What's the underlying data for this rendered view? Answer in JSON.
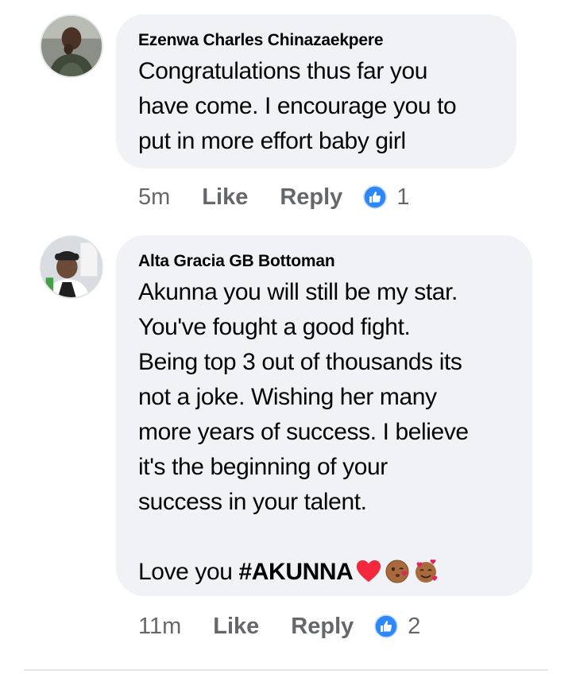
{
  "comments": [
    {
      "author": "Ezenwa Charles Chinazaekpere",
      "lines": [
        "Congratulations thus far you",
        "have come. I encourage you to",
        "put in more effort baby girl"
      ],
      "time": "5m",
      "like_label": "Like",
      "reply_label": "Reply",
      "reaction_count": "1"
    },
    {
      "author": "Alta Gracia GB Bottoman",
      "lines": [
        "Akunna you will still be my star.",
        "You've fought a good fight.",
        "Being top 3 out of thousands its",
        "not a joke. Wishing her many",
        "more years of success. I believe",
        "it's the beginning of your",
        "success in your talent."
      ],
      "closing_prefix": "Love you ",
      "closing_hashtag": "#AKUNNA",
      "time": "11m",
      "like_label": "Like",
      "reply_label": "Reply",
      "reaction_count": "2"
    }
  ],
  "icons": {
    "reaction": "like-thumbs-up-icon",
    "emojis": [
      "red-heart-icon",
      "kissing-face-icon",
      "smiling-face-with-hearts-icon"
    ]
  },
  "colors": {
    "bubble": "#f0f2f5",
    "meta_text": "#65676b",
    "like_blue": "#1877f2",
    "heart_red": "#e0245e"
  }
}
